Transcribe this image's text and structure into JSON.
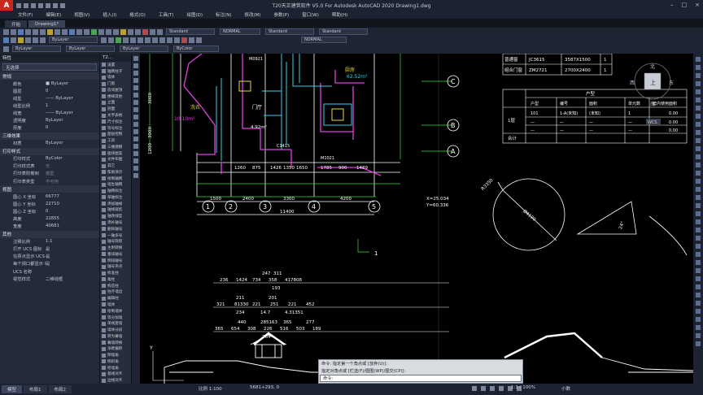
{
  "app": {
    "logo": "A",
    "title": "T20天正建筑软件 V5.0 For Autodesk AutoCAD 2020    Drawing1.dwg"
  },
  "menu": [
    "文件(F)",
    "编辑(E)",
    "视图(V)",
    "插入(I)",
    "格式(O)",
    "工具(T)",
    "绘图(D)",
    "标注(N)",
    "修改(M)",
    "参数(P)",
    "窗口(W)",
    "帮助(H)"
  ],
  "tabs": [
    "开始",
    "Drawing1*"
  ],
  "toolbar": {
    "layer_combo": "ByLayer",
    "style_combo1": "Standard",
    "style_combo2": "NORMAL",
    "style_combo3": "Standard",
    "style_combo4": "Standard",
    "style_combo5": "NORMAL",
    "bylayer1": "ByLayer",
    "bylayer2": "ByLayer",
    "bylayer3": "ByLayer",
    "bycolor": "ByColor"
  },
  "properties": {
    "header": "特性",
    "selection": "无选择",
    "sections": [
      {
        "title": "常规",
        "rows": [
          [
            "颜色",
            "■ ByLayer"
          ],
          [
            "图层",
            "0"
          ],
          [
            "线型",
            "—— ByLayer"
          ],
          [
            "线型比例",
            "1"
          ],
          [
            "线宽",
            "—— ByLayer"
          ],
          [
            "透明度",
            "ByLayer"
          ],
          [
            "厚度",
            "0"
          ]
        ]
      },
      {
        "title": "三维效果",
        "rows": [
          [
            "材质",
            "ByLayer"
          ]
        ]
      },
      {
        "title": "打印样式",
        "rows": [
          [
            "打印样式",
            "ByColor"
          ],
          [
            "打印样式表",
            "无"
          ],
          [
            "打印表附着到",
            "模型"
          ],
          [
            "打印表类型",
            "不可用"
          ]
        ]
      },
      {
        "title": "视图",
        "rows": [
          [
            "圆心 X 坐标",
            "66777"
          ],
          [
            "圆心 Y 坐标",
            "22710"
          ],
          [
            "圆心 Z 坐标",
            "0"
          ],
          [
            "高度",
            "22855"
          ],
          [
            "宽度",
            "40681"
          ]
        ]
      },
      {
        "title": "其他",
        "rows": [
          [
            "注释比例",
            "1:1"
          ],
          [
            "打开 UCS 图标",
            "是"
          ],
          [
            "在原点显示 UCS 图标",
            "是"
          ],
          [
            "每个视口都显示 UCS",
            "是"
          ],
          [
            "UCS 名称",
            ""
          ],
          [
            "视觉样式",
            "二维线框"
          ]
        ]
      }
    ]
  },
  "palette": {
    "header": "T2...",
    "items": [
      "设置",
      "轴网柱子",
      "墙体",
      "门窗",
      "房间屋顶",
      "楼梯其他",
      "立面",
      "剖面",
      "文字表格",
      "尺寸标注",
      "符号标注",
      "图层控制",
      "工具",
      "三维建模",
      "图块图案",
      "文件布图",
      "其它",
      "帮助演示",
      "绘制轴网",
      "墙生轴网",
      "轴网标注",
      "单轴标注",
      "添加轴线",
      "轴线裁剪",
      "轴改线型",
      "添补轴号",
      "删除轴号",
      "一轴多号",
      "轴号隐现",
      "主附转换",
      "重排轴号",
      "倒排轴号",
      "轴号夹点",
      "标准柱",
      "角柱",
      "构造柱",
      "柱齐墙边",
      "编辑柱",
      "墙体",
      "绘制墙体",
      "等分加墙",
      "单线变墙",
      "墙体分段",
      "转为幕墙",
      "幕墙转换",
      "净距偏移",
      "倒墙角",
      "倒斜角",
      "修墙角",
      "基线对齐",
      "边线对齐",
      "净距偏移"
    ]
  },
  "drawing": {
    "room1_label": "门厅",
    "room1_area": "10.10m²",
    "room2_label": "厨房",
    "room2_area": "62.52m²",
    "room3_label": "洗衣",
    "room3_area": "4.92m²",
    "room4_code": "M1021",
    "room4_code2": "M0921",
    "wall_label": "C1415",
    "grid_letters": [
      "C",
      "B",
      "A"
    ],
    "grid_numbers": [
      "1",
      "2",
      "3",
      "4",
      "5"
    ],
    "dim_top": [
      "1260",
      "875",
      "1426",
      "1350",
      "1650",
      "1785",
      "900",
      "1489"
    ],
    "dim_mid": [
      "1500",
      "2400",
      "3300",
      "4200"
    ],
    "dim_total": "11400",
    "dim_left": [
      "3000",
      "3000",
      "1200"
    ],
    "coord_x": "X=25.034",
    "coord_y": "Y=60.336",
    "ucs_mark": "1",
    "circle_r": "R3350",
    "circle_d": "Ø4100",
    "angle_label": "24°",
    "elev_dims_1": [
      "236",
      "1424",
      "734",
      "358",
      "417808"
    ],
    "elev_dims_1b": [
      "247",
      "311"
    ],
    "elev_dims_1c": "193",
    "elev_dims_2": [
      "321",
      "81330",
      "221",
      "251",
      "221",
      "452"
    ],
    "elev_dims_2b": [
      "211",
      "201"
    ],
    "elev_dims_2c": [
      "234",
      "14.7",
      "4.31351"
    ],
    "elev_dims_3": [
      "365",
      "654",
      "308",
      "226",
      "516",
      "503",
      "189"
    ],
    "elev_dims_3b": [
      "440",
      "285163",
      "365",
      "277"
    ],
    "elev_dims_3c": "764"
  },
  "table1": {
    "rows": [
      [
        "普通窗",
        "JC3615",
        "3587X1500",
        "1"
      ],
      [
        "组合门窗",
        "ZM2721",
        "2700X2400",
        "1"
      ]
    ]
  },
  "table2": {
    "title": "户型",
    "headers": [
      "户型",
      "编号",
      "面积",
      "单元数",
      "套内使用面积"
    ],
    "row_label_1": "1层",
    "row_label_2": "合计",
    "rows": [
      [
        "101",
        "1-A(未知)",
        "(未知)",
        "1",
        "0.00"
      ],
      [
        "—",
        "—",
        "—",
        "—",
        "0.00"
      ],
      [
        "—",
        "—",
        "—",
        "—",
        "0.00"
      ]
    ]
  },
  "viewcube": {
    "north": "北",
    "top": "上",
    "west": "西",
    "east": "东",
    "south": "南",
    "wcs": "WCS"
  },
  "command": {
    "line1": "命令: 指定第一个角点或 [放弃(U)]:",
    "line2": "指定对角点或 [栏选(F)/圈围(WP)/圈交(CP)]:",
    "input": "命令:"
  },
  "status": {
    "tabs": [
      "模型",
      "布局1",
      "布局2"
    ],
    "scale": "比例 1:100",
    "coord": "5681+293, 0",
    "zoom": "1:1 / 100%",
    "mode": "小数"
  }
}
